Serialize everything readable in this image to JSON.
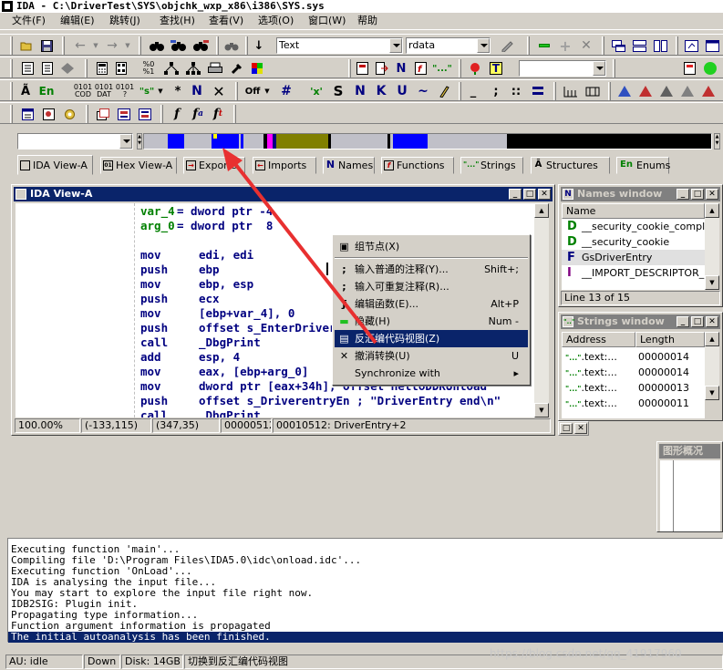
{
  "title": "IDA - C:\\DriverTest\\SYS\\objchk_wxp_x86\\i386\\SYS.sys",
  "menu": [
    "文件(F)",
    "编辑(E)",
    "跳转(J)",
    "查找(H)",
    "查看(V)",
    "选项(O)",
    "窗口(W)",
    "帮助"
  ],
  "toolbar": {
    "segment_combo": "Text",
    "section_combo": "rdata",
    "row2_labels": [
      "En",
      "0101 COD",
      "0101 DAT",
      "0101 ?"
    ],
    "row3_labels": [
      "Off",
      "#",
      "'x'",
      "S",
      "N",
      "K",
      "U",
      "~",
      "_",
      ";",
      "::"
    ]
  },
  "tabs": [
    {
      "label": "IDA View-A",
      "icon": "ida-view-icon",
      "active": true
    },
    {
      "label": "Hex View-A",
      "icon": "hex-view-icon"
    },
    {
      "label": "Exports",
      "icon": "exports-icon"
    },
    {
      "label": "Imports",
      "icon": "imports-icon"
    },
    {
      "label": "Names",
      "icon": "names-icon"
    },
    {
      "label": "Functions",
      "icon": "functions-icon"
    },
    {
      "label": "Strings",
      "icon": "strings-icon"
    },
    {
      "label": "Structures",
      "icon": "structures-icon"
    },
    {
      "label": "Enums",
      "icon": "enums-icon"
    }
  ],
  "ida_view": {
    "title": "IDA View-A",
    "lines": [
      {
        "a": "var_4",
        "b": "= dword ptr -4"
      },
      {
        "a": "arg_0",
        "b": "= dword ptr  8"
      },
      {
        "a": "",
        "b": ""
      },
      {
        "m": "mov",
        "o": "edi, edi"
      },
      {
        "m": "push",
        "o": "ebp"
      },
      {
        "m": "mov",
        "o": "ebp, esp"
      },
      {
        "m": "push",
        "o": "ecx"
      },
      {
        "m": "mov",
        "o": "[ebp+var_4], 0"
      },
      {
        "m": "push",
        "o": "offset s_EnterDriverEntry"
      },
      {
        "m": "call",
        "o": "_DbgPrint"
      },
      {
        "m": "add",
        "o": "esp, 4"
      },
      {
        "m": "mov",
        "o": "eax, [ebp+arg_0]"
      },
      {
        "m": "mov",
        "o": "dword ptr [eax+34h], offset HelloDDKUnload"
      },
      {
        "m": "push",
        "o": "offset s_DriverentryEn ; \"DriverEntry end\\n\""
      },
      {
        "m": "call",
        "o": "_DbgPrint"
      }
    ],
    "status": [
      "100.00%",
      "(-133,115)",
      "(347,35)",
      "00000512",
      "00010512: DriverEntry+2"
    ]
  },
  "context_menu": [
    {
      "label": "组节点(X)",
      "shortcut": "",
      "icon": "group-nodes-icon"
    },
    {
      "sep": true
    },
    {
      "label": "输入普通的注释(Y)...",
      "shortcut": "Shift+;",
      "icon": "comment-icon"
    },
    {
      "label": "输入可重复注释(R)...",
      "shortcut": "",
      "icon": "repeatable-comment-icon"
    },
    {
      "label": "编辑函数(E)...",
      "shortcut": "Alt+P",
      "icon": "edit-function-icon"
    },
    {
      "label": "隐藏(H)",
      "shortcut": "Num -",
      "icon": "hide-icon"
    },
    {
      "label": "反汇编代码视图(Z)",
      "shortcut": "",
      "icon": "text-view-icon",
      "highlight": true
    },
    {
      "label": "撤消转换(U)",
      "shortcut": "U",
      "icon": "undefine-icon"
    },
    {
      "label": "Synchronize with",
      "shortcut": "▸",
      "icon": ""
    }
  ],
  "names_window": {
    "title": "Names window",
    "header": "Name",
    "rows": [
      {
        "icon": "D",
        "name": "__security_cookie_complement"
      },
      {
        "icon": "D",
        "name": "__security_cookie"
      },
      {
        "icon": "F",
        "name": "GsDriverEntry"
      },
      {
        "icon": "I",
        "name": "__IMPORT_DESCRIPTOR_..."
      }
    ],
    "status": "Line 13 of 15"
  },
  "strings_window": {
    "title": "Strings window",
    "headers": [
      "Address",
      "Length"
    ],
    "rows": [
      {
        "addr": ".text:...",
        "len": "00000014"
      },
      {
        "addr": ".text:...",
        "len": "00000014"
      },
      {
        "addr": ".text:...",
        "len": "00000013"
      },
      {
        "addr": ".text:...",
        "len": "00000011"
      }
    ]
  },
  "graph_overview": {
    "title": "图形概况"
  },
  "output": [
    "Executing function 'main'...",
    "Compiling file 'D:\\Program Files\\IDA5.0\\idc\\onload.idc'...",
    "Executing function 'OnLoad'...",
    "IDA is analysing the input file...",
    "You may start to explore the input file right now.",
    "IDB2SIG: Plugin init.",
    "Propagating type information...",
    "Function argument information is propagated",
    "The initial autoanalysis has been finished."
  ],
  "statusbar": [
    "AU:  idle",
    "Down",
    "Disk: 14GB",
    "切换到反汇编代码视图"
  ],
  "watermark": "https://blog.csdn.net/qq_41917960",
  "colors": {
    "selection": "#0a246a",
    "face": "#d4d0c8",
    "arrow": "#e83030"
  }
}
